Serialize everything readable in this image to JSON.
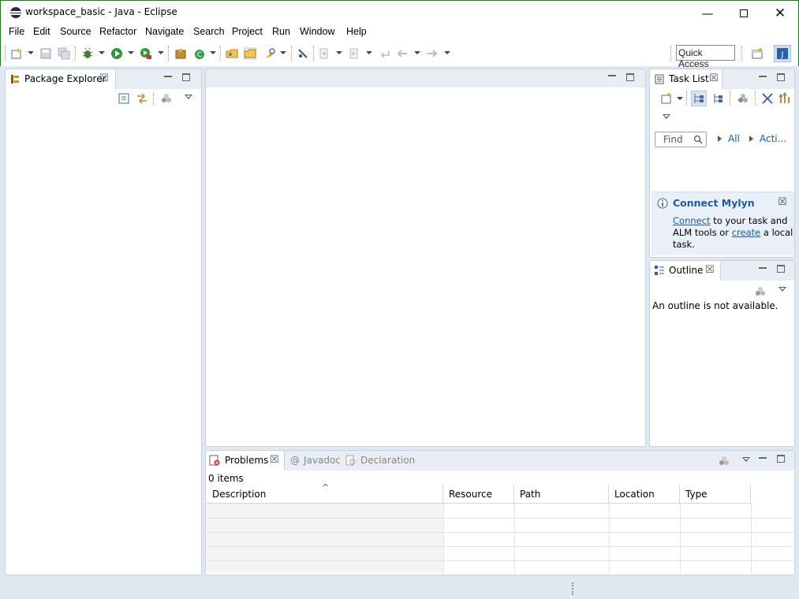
{
  "window": {
    "title": "workspace_basic - Java - Eclipse"
  },
  "menu": [
    "File",
    "Edit",
    "Source",
    "Refactor",
    "Navigate",
    "Search",
    "Project",
    "Run",
    "Window",
    "Help"
  ],
  "toolbar": {
    "quick_access": "Quick Access"
  },
  "package_explorer": {
    "title": "Package Explorer"
  },
  "task_list": {
    "title": "Task List",
    "find_placeholder": "Find",
    "all_label": "All",
    "activate_label": "Acti..."
  },
  "connect_mylyn": {
    "title": "Connect Mylyn",
    "connect_link": "Connect",
    "text1": " to your task and",
    "text2a": "ALM tools or ",
    "create_link": "create",
    "text2b": " a local",
    "text3": "task."
  },
  "outline": {
    "title": "Outline",
    "message": "An outline is not available."
  },
  "bottom": {
    "tabs": [
      "Problems",
      "Javadoc",
      "Declaration"
    ],
    "count": "0 items",
    "columns": [
      "Description",
      "Resource",
      "Path",
      "Location",
      "Type"
    ]
  },
  "colors": {
    "link": "#1e5aa8",
    "panel_header": "#e9eef5",
    "background": "#dfe7f0"
  }
}
